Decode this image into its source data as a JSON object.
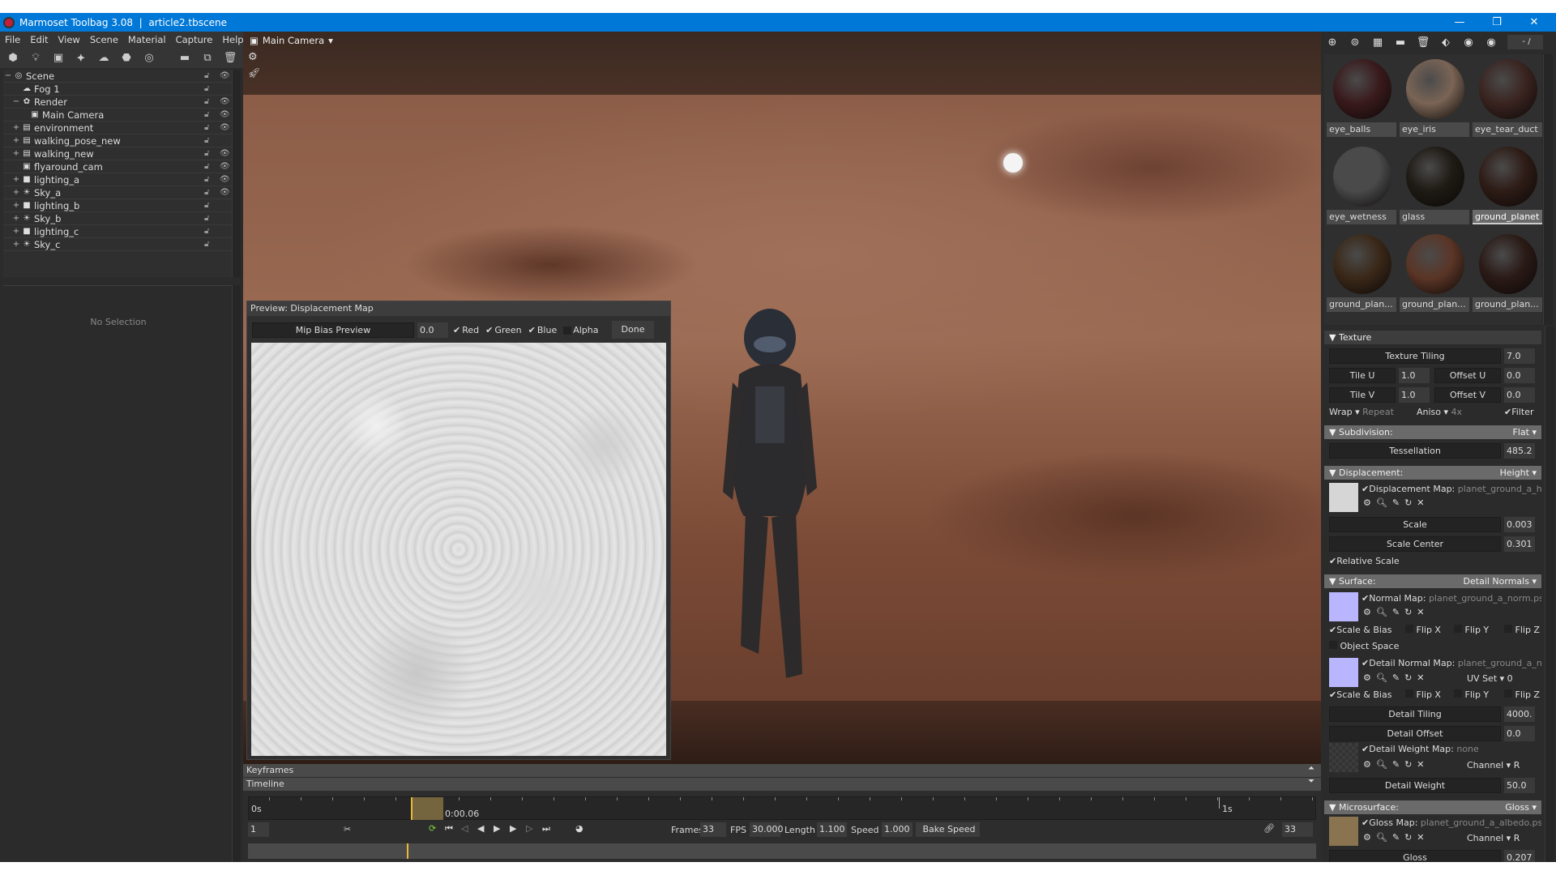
{
  "window": {
    "title": "Marmoset Toolbag 3.08  |  article2.tbscene",
    "minimize": "—",
    "maximize": "❐",
    "close": "✕"
  },
  "menu": [
    "File",
    "Edit",
    "View",
    "Scene",
    "Material",
    "Capture",
    "Help"
  ],
  "scene_tree": [
    {
      "label": "Scene",
      "expander": "−",
      "icon": "◎",
      "lock": true,
      "eye": true
    },
    {
      "label": "Fog 1",
      "expander": "",
      "icon": "☁",
      "lock": true,
      "eye": false
    },
    {
      "label": "Render",
      "expander": "−",
      "icon": "✿",
      "lock": true,
      "eye": true
    },
    {
      "label": "Main Camera",
      "expander": "",
      "icon": "▣",
      "lock": true,
      "eye": true
    },
    {
      "label": "environment",
      "expander": "+",
      "icon": "▤",
      "lock": true,
      "eye": true
    },
    {
      "label": "walking_pose_new",
      "expander": "+",
      "icon": "▤",
      "lock": true,
      "eye": false
    },
    {
      "label": "walking_new",
      "expander": "+",
      "icon": "▤",
      "lock": true,
      "eye": true
    },
    {
      "label": "flyaround_cam",
      "expander": "",
      "icon": "▣",
      "lock": true,
      "eye": true
    },
    {
      "label": "lighting_a",
      "expander": "+",
      "icon": "■",
      "lock": true,
      "eye": true
    },
    {
      "label": "Sky_a",
      "expander": "+",
      "icon": "☀",
      "lock": true,
      "eye": true
    },
    {
      "label": "lighting_b",
      "expander": "+",
      "icon": "■",
      "lock": true,
      "eye": false
    },
    {
      "label": "Sky_b",
      "expander": "+",
      "icon": "☀",
      "lock": true,
      "eye": false
    },
    {
      "label": "lighting_c",
      "expander": "+",
      "icon": "■",
      "lock": true,
      "eye": false
    },
    {
      "label": "Sky_c",
      "expander": "+",
      "icon": "☀",
      "lock": true,
      "eye": false
    }
  ],
  "lower_left": {
    "no_selection": "No Selection"
  },
  "viewport": {
    "camera": "Main Camera",
    "camera_caret": "▾"
  },
  "preview": {
    "title": "Preview: Displacement Map",
    "mip_label": "Mip Bias Preview",
    "mip_value": "0.0",
    "channels": [
      {
        "label": "Red",
        "checked": true
      },
      {
        "label": "Green",
        "checked": true
      },
      {
        "label": "Blue",
        "checked": true
      },
      {
        "label": "Alpha",
        "checked": false
      }
    ],
    "done": "Done"
  },
  "timeline": {
    "keyframes": "Keyframes",
    "timeline": "Timeline",
    "start_label": "0s",
    "end_label": "1s",
    "current_time": "0:00.06",
    "current_frame": "1",
    "frames_label": "Frames",
    "frames": "33",
    "fps_label": "FPS",
    "fps": "30.000",
    "length_label": "Length",
    "length": "1.100",
    "speed_label": "Speed",
    "speed": "1.000",
    "bake_speed": "Bake Speed",
    "end_frame": "33"
  },
  "materials_toolbar": {
    "page": "- /",
    "plus": "+"
  },
  "materials": [
    {
      "name": "eye_balls",
      "color": "#3a1a1c",
      "selected": false
    },
    {
      "name": "eye_iris",
      "color": "#7a6455",
      "selected": false
    },
    {
      "name": "eye_tear_duct",
      "color": "#3a2420",
      "selected": false
    },
    {
      "name": "eye_wetness",
      "color": "#4a4a4a",
      "selected": false
    },
    {
      "name": "glass",
      "color": "#1e1a14",
      "selected": false
    },
    {
      "name": "ground_planet",
      "color": "#2e1c16",
      "selected": true
    },
    {
      "name": "ground_plan...",
      "color": "#3a2818",
      "selected": false
    },
    {
      "name": "ground_plan...",
      "color": "#5a3526",
      "selected": false
    },
    {
      "name": "ground_plan...",
      "color": "#2a1a16",
      "selected": false
    }
  ],
  "props": {
    "texture": {
      "header": "Texture",
      "tiling_label": "Texture Tiling",
      "tiling": "7.0",
      "tile_u_label": "Tile U",
      "tile_u": "1.0",
      "offset_u_label": "Offset U",
      "offset_u": "0.0",
      "tile_v_label": "Tile V",
      "tile_v": "1.0",
      "offset_v_label": "Offset V",
      "offset_v": "0.0",
      "wrap_label": "Wrap",
      "wrap": "Repeat",
      "aniso_label": "Aniso",
      "aniso": "4x",
      "filter": "Filter"
    },
    "subdivision": {
      "header": "Subdivision:",
      "mode": "Flat",
      "tess_label": "Tessellation",
      "tess": "485.2"
    },
    "displacement": {
      "header": "Displacement:",
      "mode": "Height",
      "map_label": "Displacement Map:",
      "map_file": "planet_ground_a_hei",
      "scale_label": "Scale",
      "scale": "0.003",
      "center_label": "Scale Center",
      "center": "0.301",
      "relative": "Relative Scale"
    },
    "surface": {
      "header": "Surface:",
      "mode": "Detail Normals",
      "normal_label": "Normal Map:",
      "normal_file": "planet_ground_a_norm.psd",
      "scale_bias": "Scale & Bias",
      "flip_x": "Flip X",
      "flip_y": "Flip Y",
      "flip_z": "Flip Z",
      "object_space": "Object Space",
      "detail_label": "Detail Normal Map:",
      "detail_file": "planet_ground_a_no",
      "uvset_label": "UV Set",
      "uvset": "0",
      "detail_tiling_label": "Detail Tiling",
      "detail_tiling": "4000.",
      "detail_offset_label": "Detail Offset",
      "detail_offset": "0.0",
      "weight_map_label": "Detail Weight Map:",
      "weight_map": "none",
      "channel_label": "Channel",
      "channel": "R",
      "detail_weight_label": "Detail Weight",
      "detail_weight": "50.0"
    },
    "microsurface": {
      "header": "Microsurface:",
      "mode": "Gloss",
      "gloss_map_label": "Gloss Map:",
      "gloss_file": "planet_ground_a_albedo.psd",
      "channel_label": "Channel",
      "channel": "R",
      "gloss_label": "Gloss",
      "gloss": "0.207"
    }
  },
  "colors": {
    "titlebar": "#0078d7",
    "panel": "#2b2b2b",
    "section_header": "#6a6a6a",
    "playhead": "#e8b93b",
    "normal_swatch": "#b9b5ff",
    "gloss_swatch": "#8a7450"
  }
}
